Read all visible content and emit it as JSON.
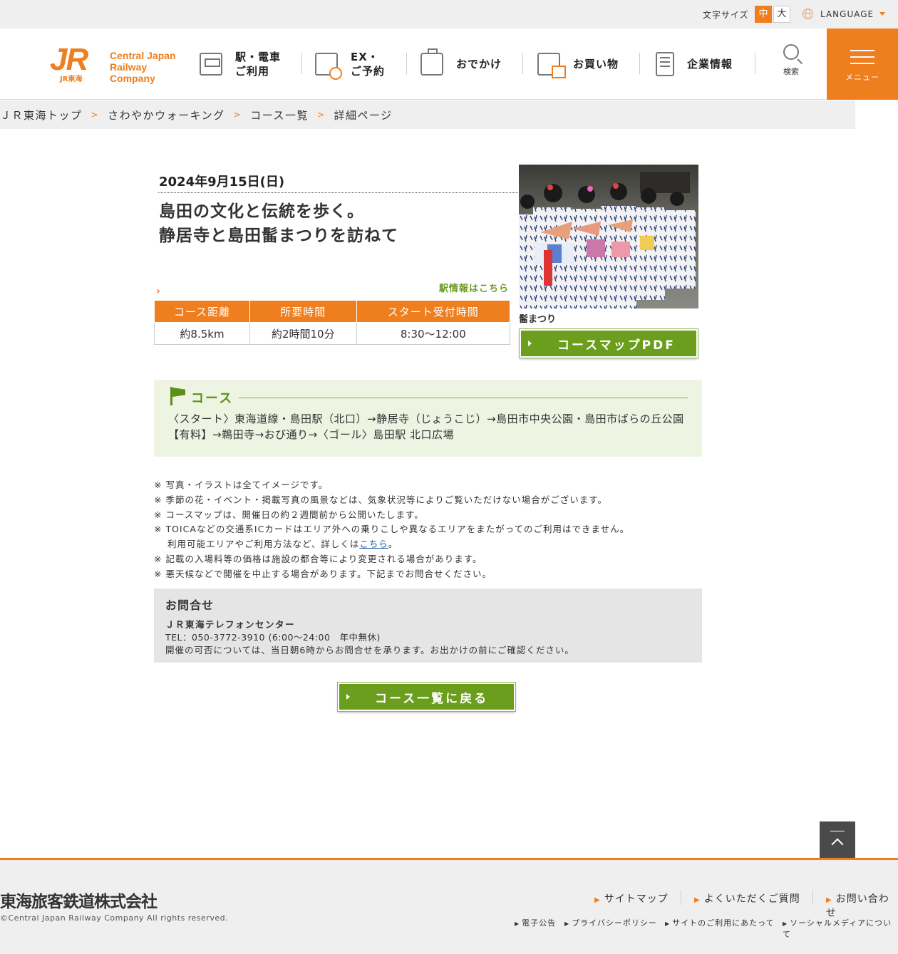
{
  "topbar": {
    "font_size_label": "文字サイズ",
    "font_size_mid": "中",
    "font_size_big": "大",
    "language_label": "LANGUAGE"
  },
  "header": {
    "logo_mark": "JR",
    "logo_sub": "JR東海",
    "logo_line1": "Central Japan",
    "logo_line2": "Railway Company",
    "nav": [
      {
        "line1": "駅・電車",
        "line2": "ご利用"
      },
      {
        "line1": "EX・",
        "line2": "ご予約"
      },
      {
        "line1": "おでかけ"
      },
      {
        "line1": "お買い物"
      },
      {
        "line1": "企業情報"
      }
    ],
    "search_label": "検索",
    "menu_label": "メニュー"
  },
  "breadcrumb": [
    "ＪＲ東海トップ",
    "さわやかウォーキング",
    "コース一覧",
    "詳細ページ"
  ],
  "event": {
    "date": "2024年9月15日(日)",
    "title_line1": "島田の文化と伝統を歩く。",
    "title_line2": "静居寺と島田髷まつりを訪ねて",
    "station_link": "駅情報はこちら",
    "photo_caption": "髷まつり",
    "pdf_button": "コースマップPDF"
  },
  "info_table": {
    "headers": [
      "コース距離",
      "所要時間",
      "スタート受付時間"
    ],
    "values": [
      "約8.5km",
      "約2時間10分",
      "8:30～12:00"
    ]
  },
  "course": {
    "heading": "コース",
    "text": "〈スタート〉東海道線・島田駅（北口）→静居寺（じょうこじ）→島田市中央公園・島田市ばらの丘公園【有料】→鵜田寺→おび通り→〈ゴール〉島田駅 北口広場"
  },
  "notes": {
    "items": [
      "※ 写真・イラストは全てイメージです。",
      "※ 季節の花・イベント・掲載写真の風景などは、気象状況等によりご覧いただけない場合がございます。",
      "※ コースマップは、開催日の約２週間前から公開いたします。",
      "※ TOICAなどの交通系ICカードはエリア外への乗りこしや異なるエリアをまたがってのご利用はできません。"
    ],
    "ic_sub_prefix": "利用可能エリアやご利用方法など、詳しくは",
    "ic_sub_link": "こちら",
    "ic_sub_suffix": "。",
    "items2": [
      "※ 記載の入場料等の価格は施設の都合等により変更される場合があります。",
      "※ 悪天候などで開催を中止する場合があります。下記までお問合せください。"
    ]
  },
  "contact": {
    "heading": "お問合せ",
    "org": "ＪＲ東海テレフォンセンター",
    "tel": "TEL：050-3772-3910 (6:00～24:00　年中無休)",
    "message": "開催の可否については、当日朝6時からお問合せを承ります。お出かけの前にご確認ください。"
  },
  "back_button": "コース一覧に戻る",
  "footer": {
    "company": "東海旅客鉄道株式会社",
    "copyright": "©Central Japan Railway Company All rights reserved.",
    "links": [
      "サイトマップ",
      "よくいただくご質問",
      "お問い合わせ"
    ],
    "small_links": [
      "電子公告",
      "プライバシーポリシー",
      "サイトのご利用にあたって",
      "ソーシャルメディアについて"
    ]
  },
  "colors": {
    "brand_orange": "#ef7e1f",
    "button_green": "#6a9e1c",
    "course_bg": "#eef4e2",
    "link_blue": "#1a5aa6"
  }
}
